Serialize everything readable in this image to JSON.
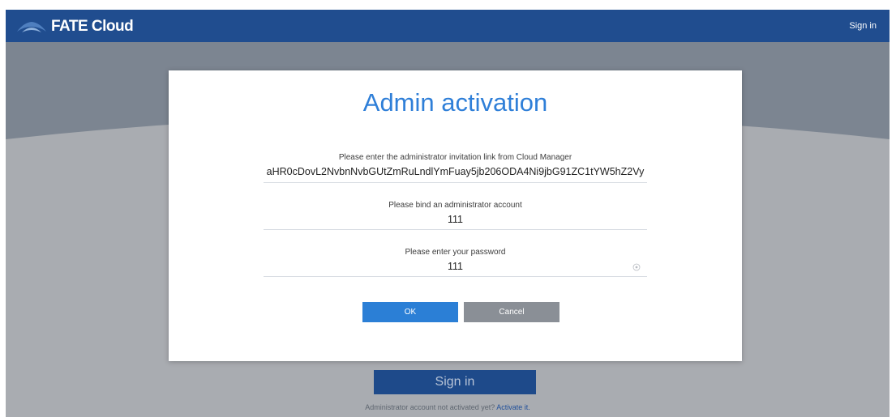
{
  "header": {
    "brand": "FATE Cloud",
    "signin_link": "Sign in"
  },
  "background": {
    "signin_button": "Sign in",
    "activate_prompt": "Administrator account not activated yet?",
    "activate_link": "Activate it."
  },
  "modal": {
    "title": "Admin activation",
    "invitation_label": "Please enter the administrator invitation link from Cloud Manager",
    "invitation_value": "aHR0cDovL2NvbnNvbGUtZmRuLndlYmFuay5jb206ODA4Ni9jbG91ZC1tYW5hZ2Vy",
    "account_label": "Please bind an administrator account",
    "account_value": "111",
    "password_label": "Please enter your password",
    "password_value": "111",
    "ok_label": "OK",
    "cancel_label": "Cancel"
  },
  "colors": {
    "header": "#204d8f",
    "accent": "#2b7fd6",
    "cancel": "#8a8f96",
    "overlay": "#7c8591"
  },
  "icons": {
    "logo": "cloud-logo-icon",
    "password_toggle": "eye-icon"
  }
}
